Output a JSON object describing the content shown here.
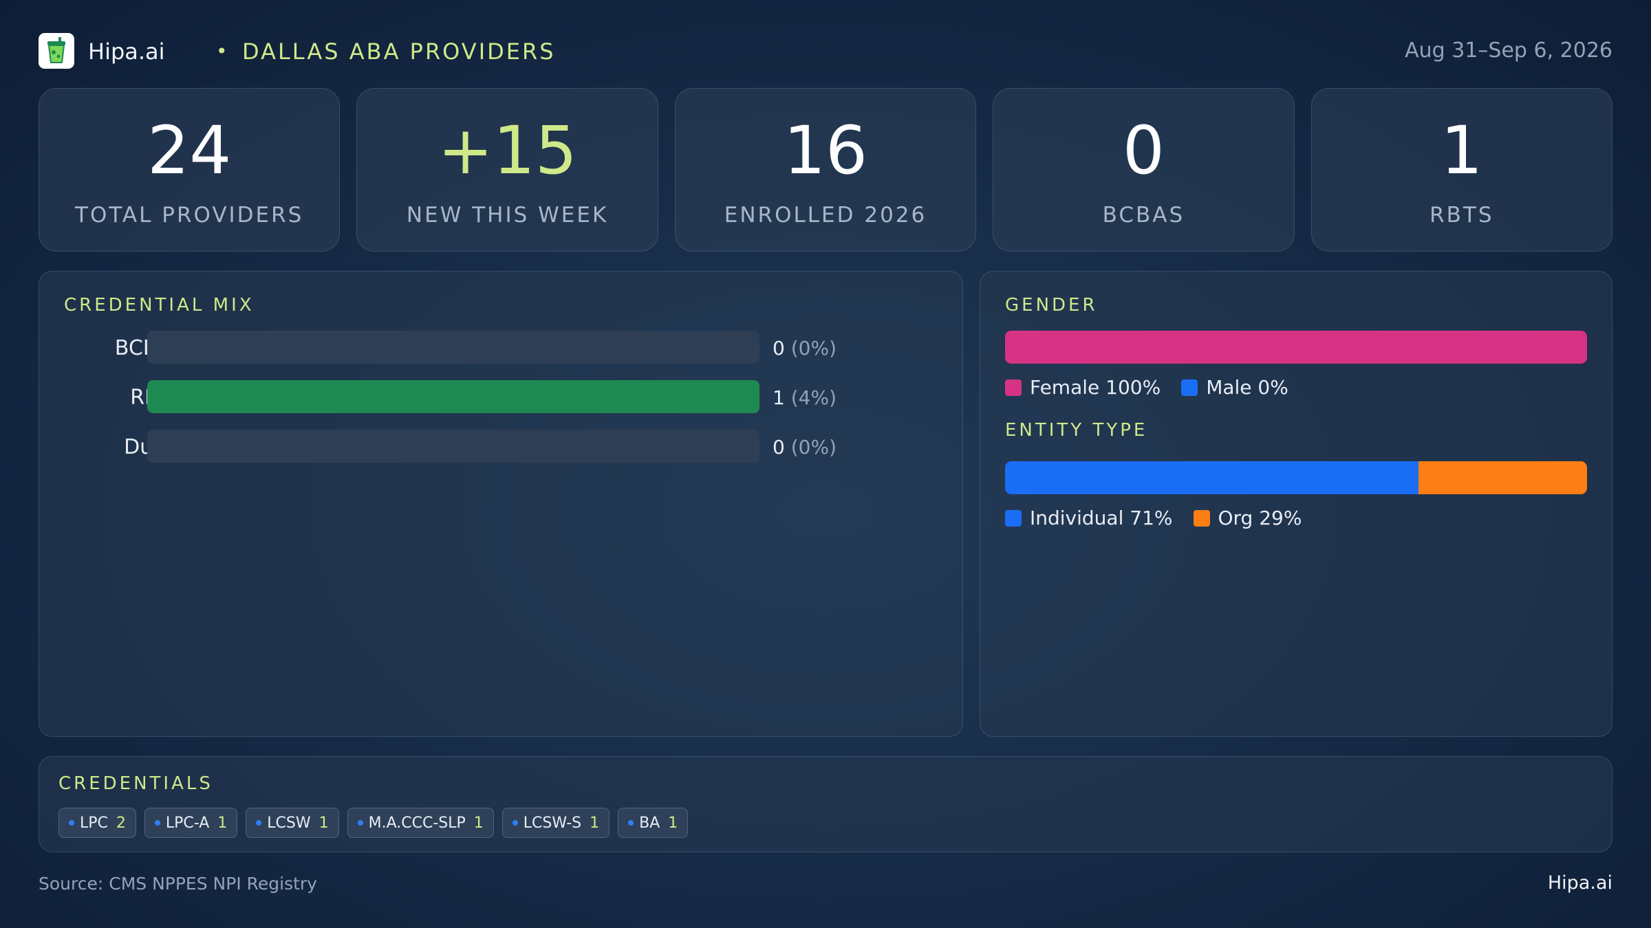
{
  "header": {
    "brand": "Hipa.ai",
    "separator": "•",
    "region": "DALLAS ABA PROVIDERS",
    "date_range": "Aug 31–Sep 6, 2026",
    "logo_icon": "drink-cup-icon"
  },
  "stats": [
    {
      "value": "24",
      "label": "TOTAL PROVIDERS"
    },
    {
      "value": "+15",
      "label": "NEW THIS WEEK"
    },
    {
      "value": "16",
      "label": "ENROLLED 2026"
    },
    {
      "value": "0",
      "label": "BCBAS"
    },
    {
      "value": "1",
      "label": "RBTS"
    }
  ],
  "credential_mix": {
    "title": "CREDENTIAL MIX",
    "rows": [
      {
        "label": "BCBA",
        "count": "0",
        "pct": "(0%)",
        "fill": 0
      },
      {
        "label": "RBT",
        "count": "1",
        "pct": "(4%)",
        "fill": 1
      },
      {
        "label": "Dual",
        "count": "0",
        "pct": "(0%)",
        "fill": 0
      }
    ],
    "fill_color": "#1e8a52"
  },
  "gender": {
    "title": "GENDER",
    "segments": [
      {
        "label": "Female 100%",
        "share": 1.0,
        "color": "#d63384"
      },
      {
        "label": "Male 0%",
        "share": 0.0,
        "color": "#1a6ef5"
      }
    ]
  },
  "entity_type": {
    "title": "ENTITY TYPE",
    "segments": [
      {
        "label": "Individual 71%",
        "share": 0.71,
        "color": "#1a6ef5"
      },
      {
        "label": "Org 29%",
        "share": 0.29,
        "color": "#fd7e14"
      }
    ]
  },
  "credentials": {
    "title": "CREDENTIALS",
    "chips": [
      {
        "name": "LPC",
        "count": "2"
      },
      {
        "name": "LPC-A",
        "count": "1"
      },
      {
        "name": "LCSW",
        "count": "1"
      },
      {
        "name": "M.A.CCC-SLP",
        "count": "1"
      },
      {
        "name": "LCSW-S",
        "count": "1"
      },
      {
        "name": "BA",
        "count": "1"
      }
    ]
  },
  "footer": {
    "source": "Source: CMS NPPES NPI Registry",
    "brand": "Hipa.ai"
  },
  "colors": {
    "accent": "#cfe98a",
    "background": "#172c48"
  }
}
